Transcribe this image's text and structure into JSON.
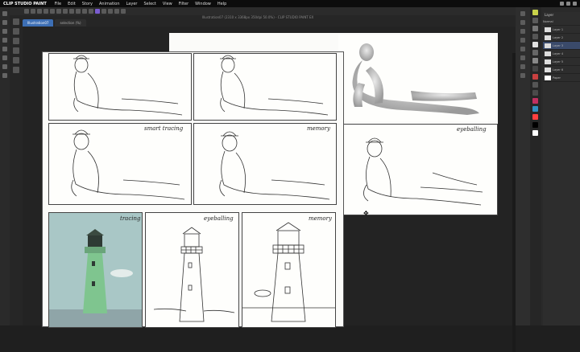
{
  "app": {
    "name": "CLIP STUDIO PAINT",
    "menu": [
      "File",
      "Edit",
      "Story",
      "Animation",
      "Layer",
      "Select",
      "View",
      "Filter",
      "Window",
      "Help"
    ]
  },
  "window": {
    "title": "Illustration07 (2310 x 3368px 350dpi 50.0%) - CLIP STUDIO PAINT EX",
    "tabs": [
      "Illustration07",
      "selection (%)"
    ]
  },
  "canvas": {
    "labels": {
      "smart_tracing": "smart tracing",
      "memory_top": "memory",
      "eyeballing": "eyeballing",
      "tracing": "tracing",
      "eyeballing_bottom": "eyeballing",
      "memory_bottom": "memory"
    }
  },
  "layers": {
    "header": "Layer",
    "items": [
      "Normal",
      "Layer 1",
      "Layer 2",
      "Layer 3",
      "Layer 4",
      "Layer 5",
      "Layer 6",
      "Paper"
    ]
  },
  "colors": {
    "accent": "#7a5cd0",
    "tab_active": "#3d6fb5",
    "photo_sky": "#a9c7c6",
    "lighthouse_green": "#7fc58f"
  }
}
